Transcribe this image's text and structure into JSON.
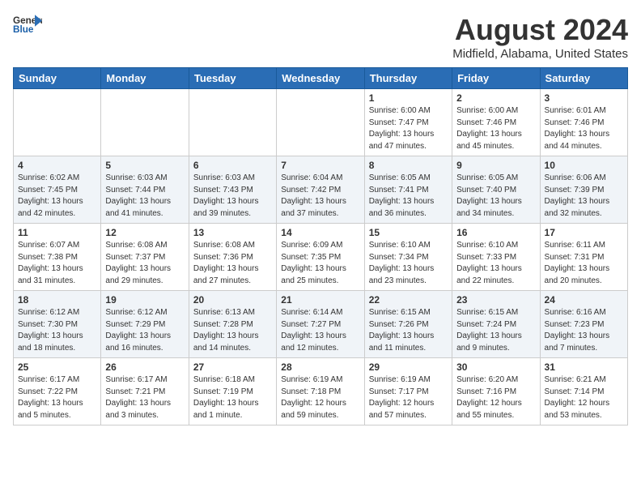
{
  "header": {
    "logo_line1": "General",
    "logo_line2": "Blue",
    "main_title": "August 2024",
    "subtitle": "Midfield, Alabama, United States"
  },
  "calendar": {
    "days_of_week": [
      "Sunday",
      "Monday",
      "Tuesday",
      "Wednesday",
      "Thursday",
      "Friday",
      "Saturday"
    ],
    "weeks": [
      [
        {
          "day": "",
          "sunrise": "",
          "sunset": "",
          "daylight": ""
        },
        {
          "day": "",
          "sunrise": "",
          "sunset": "",
          "daylight": ""
        },
        {
          "day": "",
          "sunrise": "",
          "sunset": "",
          "daylight": ""
        },
        {
          "day": "",
          "sunrise": "",
          "sunset": "",
          "daylight": ""
        },
        {
          "day": "1",
          "sunrise": "6:00 AM",
          "sunset": "7:47 PM",
          "daylight": "13 hours and 47 minutes."
        },
        {
          "day": "2",
          "sunrise": "6:00 AM",
          "sunset": "7:46 PM",
          "daylight": "13 hours and 45 minutes."
        },
        {
          "day": "3",
          "sunrise": "6:01 AM",
          "sunset": "7:46 PM",
          "daylight": "13 hours and 44 minutes."
        }
      ],
      [
        {
          "day": "4",
          "sunrise": "6:02 AM",
          "sunset": "7:45 PM",
          "daylight": "13 hours and 42 minutes."
        },
        {
          "day": "5",
          "sunrise": "6:03 AM",
          "sunset": "7:44 PM",
          "daylight": "13 hours and 41 minutes."
        },
        {
          "day": "6",
          "sunrise": "6:03 AM",
          "sunset": "7:43 PM",
          "daylight": "13 hours and 39 minutes."
        },
        {
          "day": "7",
          "sunrise": "6:04 AM",
          "sunset": "7:42 PM",
          "daylight": "13 hours and 37 minutes."
        },
        {
          "day": "8",
          "sunrise": "6:05 AM",
          "sunset": "7:41 PM",
          "daylight": "13 hours and 36 minutes."
        },
        {
          "day": "9",
          "sunrise": "6:05 AM",
          "sunset": "7:40 PM",
          "daylight": "13 hours and 34 minutes."
        },
        {
          "day": "10",
          "sunrise": "6:06 AM",
          "sunset": "7:39 PM",
          "daylight": "13 hours and 32 minutes."
        }
      ],
      [
        {
          "day": "11",
          "sunrise": "6:07 AM",
          "sunset": "7:38 PM",
          "daylight": "13 hours and 31 minutes."
        },
        {
          "day": "12",
          "sunrise": "6:08 AM",
          "sunset": "7:37 PM",
          "daylight": "13 hours and 29 minutes."
        },
        {
          "day": "13",
          "sunrise": "6:08 AM",
          "sunset": "7:36 PM",
          "daylight": "13 hours and 27 minutes."
        },
        {
          "day": "14",
          "sunrise": "6:09 AM",
          "sunset": "7:35 PM",
          "daylight": "13 hours and 25 minutes."
        },
        {
          "day": "15",
          "sunrise": "6:10 AM",
          "sunset": "7:34 PM",
          "daylight": "13 hours and 23 minutes."
        },
        {
          "day": "16",
          "sunrise": "6:10 AM",
          "sunset": "7:33 PM",
          "daylight": "13 hours and 22 minutes."
        },
        {
          "day": "17",
          "sunrise": "6:11 AM",
          "sunset": "7:31 PM",
          "daylight": "13 hours and 20 minutes."
        }
      ],
      [
        {
          "day": "18",
          "sunrise": "6:12 AM",
          "sunset": "7:30 PM",
          "daylight": "13 hours and 18 minutes."
        },
        {
          "day": "19",
          "sunrise": "6:12 AM",
          "sunset": "7:29 PM",
          "daylight": "13 hours and 16 minutes."
        },
        {
          "day": "20",
          "sunrise": "6:13 AM",
          "sunset": "7:28 PM",
          "daylight": "13 hours and 14 minutes."
        },
        {
          "day": "21",
          "sunrise": "6:14 AM",
          "sunset": "7:27 PM",
          "daylight": "13 hours and 12 minutes."
        },
        {
          "day": "22",
          "sunrise": "6:15 AM",
          "sunset": "7:26 PM",
          "daylight": "13 hours and 11 minutes."
        },
        {
          "day": "23",
          "sunrise": "6:15 AM",
          "sunset": "7:24 PM",
          "daylight": "13 hours and 9 minutes."
        },
        {
          "day": "24",
          "sunrise": "6:16 AM",
          "sunset": "7:23 PM",
          "daylight": "13 hours and 7 minutes."
        }
      ],
      [
        {
          "day": "25",
          "sunrise": "6:17 AM",
          "sunset": "7:22 PM",
          "daylight": "13 hours and 5 minutes."
        },
        {
          "day": "26",
          "sunrise": "6:17 AM",
          "sunset": "7:21 PM",
          "daylight": "13 hours and 3 minutes."
        },
        {
          "day": "27",
          "sunrise": "6:18 AM",
          "sunset": "7:19 PM",
          "daylight": "13 hours and 1 minute."
        },
        {
          "day": "28",
          "sunrise": "6:19 AM",
          "sunset": "7:18 PM",
          "daylight": "12 hours and 59 minutes."
        },
        {
          "day": "29",
          "sunrise": "6:19 AM",
          "sunset": "7:17 PM",
          "daylight": "12 hours and 57 minutes."
        },
        {
          "day": "30",
          "sunrise": "6:20 AM",
          "sunset": "7:16 PM",
          "daylight": "12 hours and 55 minutes."
        },
        {
          "day": "31",
          "sunrise": "6:21 AM",
          "sunset": "7:14 PM",
          "daylight": "12 hours and 53 minutes."
        }
      ]
    ]
  }
}
